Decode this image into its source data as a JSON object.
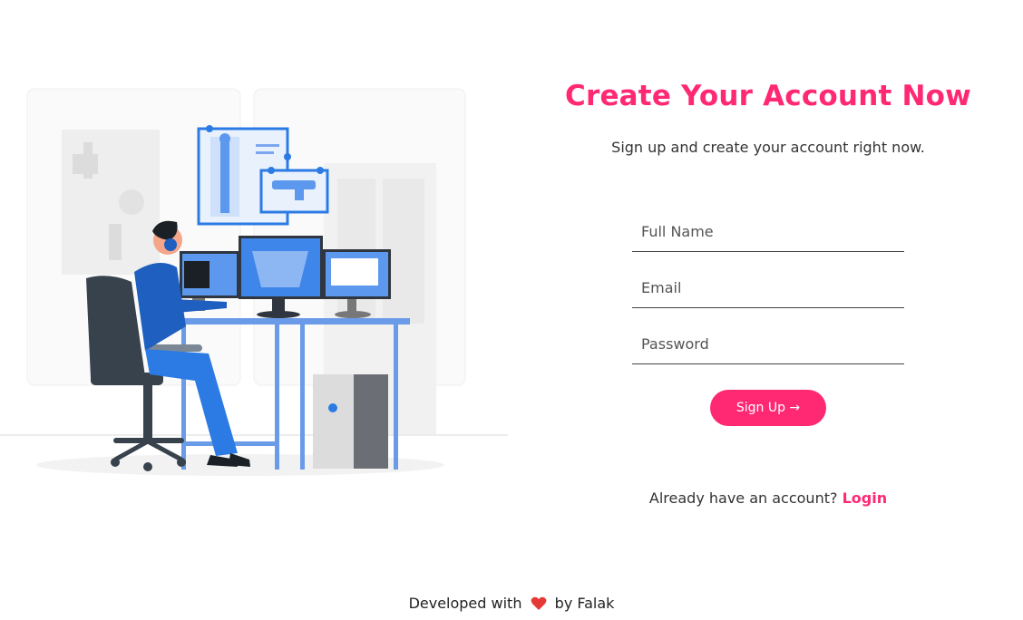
{
  "title": "Create Your Account Now",
  "subtitle": "Sign up and create your account right now.",
  "form": {
    "full_name_placeholder": "Full Name",
    "email_placeholder": "Email",
    "password_placeholder": "Password",
    "full_name_value": "",
    "email_value": "",
    "password_value": "",
    "submit_label": "Sign Up →"
  },
  "login": {
    "prompt": "Already have an account?",
    "link_label": "Login"
  },
  "footer": {
    "prefix": "Developed with",
    "suffix": "by Falak",
    "heart_icon": "heart-icon"
  },
  "colors": {
    "accent": "#ff2873",
    "blue": "#2c7be5"
  }
}
